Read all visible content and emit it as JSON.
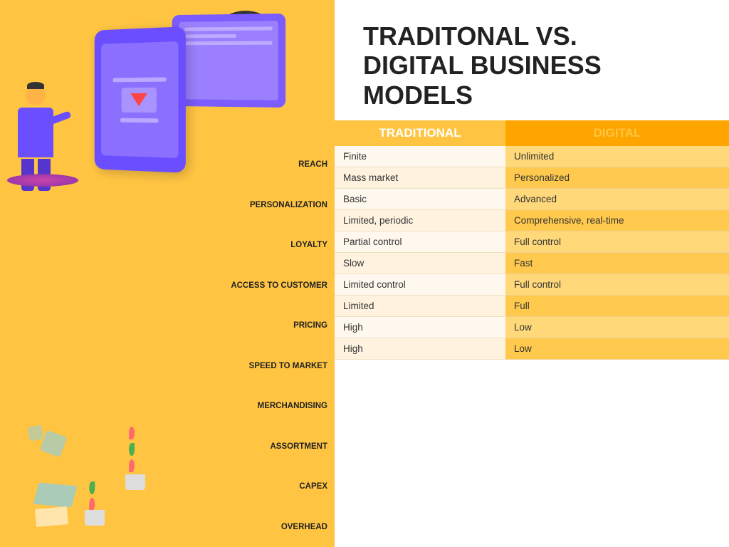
{
  "title": {
    "line1": "TRADITONAL VS.",
    "line2": "DIGITAL BUSINESS",
    "line3": "MODELS"
  },
  "columns": {
    "traditional": "TRADITIONAL",
    "digital": "DIGITAL"
  },
  "rows": [
    {
      "label": "REACH",
      "traditional": "Finite",
      "digital": "Unlimited"
    },
    {
      "label": "PERSONALIZATION",
      "traditional": "Mass market",
      "digital": "Personalized"
    },
    {
      "label": "LOYALTY",
      "traditional": "Basic",
      "digital": "Advanced"
    },
    {
      "label": "ACCESS TO CUSTOMER",
      "traditional": "Limited, periodic",
      "digital": "Comprehensive, real-time"
    },
    {
      "label": "PRICING",
      "traditional": "Partial control",
      "digital": "Full control"
    },
    {
      "label": "SPEED TO MARKET",
      "traditional": "Slow",
      "digital": "Fast"
    },
    {
      "label": "MERCHANDISING",
      "traditional": "Limited control",
      "digital": "Full control"
    },
    {
      "label": "ASSORTMENT",
      "traditional": "Limited",
      "digital": "Full"
    },
    {
      "label": "CAPEX",
      "traditional": "High",
      "digital": "Low"
    },
    {
      "label": "OVERHEAD",
      "traditional": "High",
      "digital": "Low"
    }
  ],
  "colors": {
    "orange": "#FFC542",
    "dark_orange": "#FFA500",
    "yellow_cell": "#FFD87A",
    "white_cell": "#fff8ee",
    "dark": "#222222"
  }
}
